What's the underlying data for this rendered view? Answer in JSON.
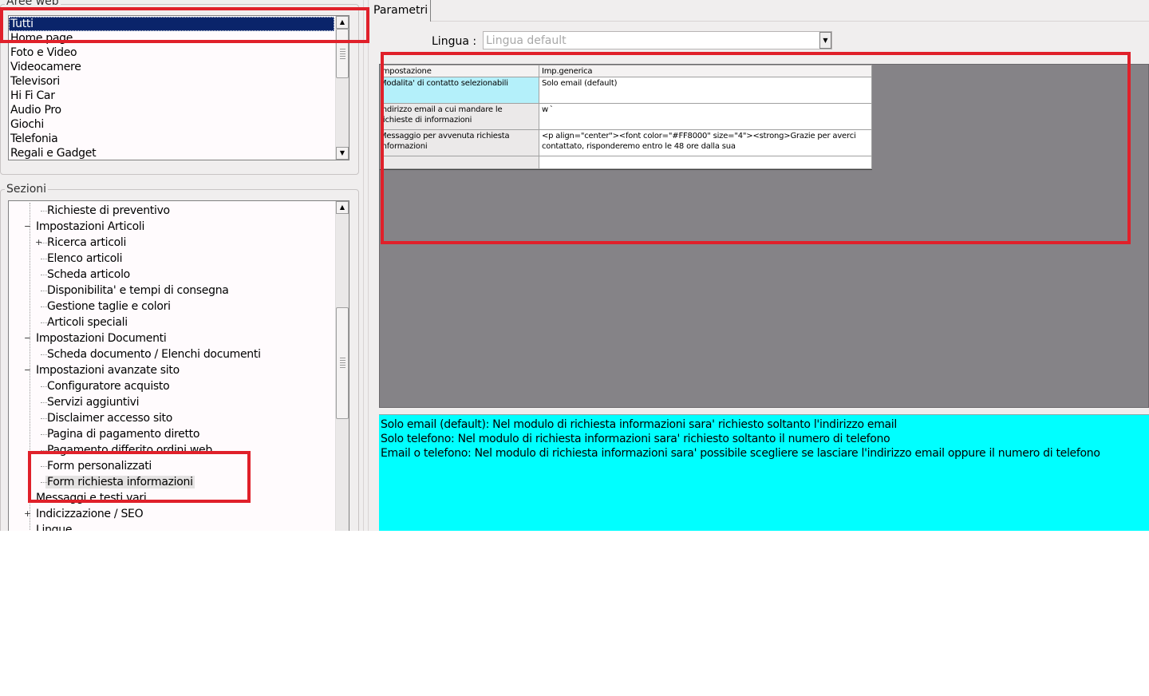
{
  "aree_web": {
    "legend": "Aree web",
    "items": [
      "Tutti",
      "Home page",
      "Foto e Video",
      "Videocamere",
      "Televisori",
      "Hi Fi Car",
      "Audio Pro",
      "Giochi",
      "Telefonia",
      "Regali e Gadget"
    ],
    "selected": "Tutti"
  },
  "sezioni": {
    "legend": "Sezioni",
    "items": [
      {
        "label": "Richieste di preventivo",
        "level": 2,
        "expander": ""
      },
      {
        "label": "Impostazioni Articoli",
        "level": 1,
        "expander": "−"
      },
      {
        "label": "Ricerca articoli",
        "level": 2,
        "expander": "+"
      },
      {
        "label": "Elenco articoli",
        "level": 2,
        "expander": ""
      },
      {
        "label": "Scheda articolo",
        "level": 2,
        "expander": ""
      },
      {
        "label": "Disponibilita' e tempi di consegna",
        "level": 2,
        "expander": ""
      },
      {
        "label": "Gestione taglie e colori",
        "level": 2,
        "expander": ""
      },
      {
        "label": "Articoli speciali",
        "level": 2,
        "expander": ""
      },
      {
        "label": "Impostazioni Documenti",
        "level": 1,
        "expander": "−"
      },
      {
        "label": "Scheda documento / Elenchi documenti",
        "level": 2,
        "expander": ""
      },
      {
        "label": "Impostazioni avanzate sito",
        "level": 1,
        "expander": "−"
      },
      {
        "label": "Configuratore acquisto",
        "level": 2,
        "expander": ""
      },
      {
        "label": "Servizi aggiuntivi",
        "level": 2,
        "expander": ""
      },
      {
        "label": "Disclaimer accesso sito",
        "level": 2,
        "expander": ""
      },
      {
        "label": "Pagina di pagamento diretto",
        "level": 2,
        "expander": ""
      },
      {
        "label": "Pagamento differito ordini web",
        "level": 2,
        "expander": ""
      },
      {
        "label": "Form personalizzati",
        "level": 2,
        "expander": ""
      },
      {
        "label": "Form richiesta informazioni",
        "level": 2,
        "expander": ""
      },
      {
        "label": "Messaggi e testi vari",
        "level": 1,
        "expander": ""
      },
      {
        "label": "Indicizzazione / SEO",
        "level": 1,
        "expander": "+"
      },
      {
        "label": "Lingue",
        "level": 1,
        "expander": ""
      }
    ],
    "selected": "Form richiesta informazioni"
  },
  "tab": {
    "label": "Parametri"
  },
  "lingua": {
    "label": "Lingua :",
    "value": "Lingua default"
  },
  "grid": {
    "headers": [
      "Impostazione",
      "Imp.generica"
    ],
    "rows": [
      {
        "setting": "Modalita' di contatto selezionabili",
        "value": "Solo email (default)"
      },
      {
        "setting": "Indirizzo email a cui mandare le richieste di informazioni",
        "value": "w `"
      },
      {
        "setting": "Messaggio per avvenuta richiesta informazioni",
        "value": "<p align=\"center\"><font color=\"#FF8000\" size=\"4\"><strong>Grazie per averci contattato, risponderemo entro le 48 ore dalla sua"
      },
      {
        "setting": "",
        "value": ""
      }
    ]
  },
  "info": {
    "lines": [
      "Solo email (default): Nel modulo di richiesta informazioni sara' richiesto soltanto l'indirizzo email",
      "Solo telefono: Nel modulo di richiesta informazioni sara' richiesto soltanto il numero di telefono",
      "Email o telefono: Nel modulo di richiesta informazioni sara' possibile scegliere se lasciare l'indirizzo email oppure il numero di telefono"
    ]
  },
  "colors": {
    "highlight": "#e0202a",
    "info_bg": "#00ffff",
    "active_cell": "#b4f0fa",
    "selection": "#0a246a"
  }
}
